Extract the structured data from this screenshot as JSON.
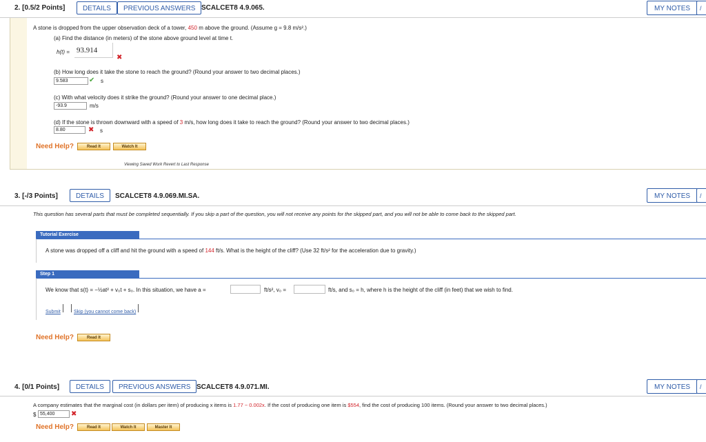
{
  "q2": {
    "number": "2.",
    "points": "[0.5/2 Points]",
    "details": "DETAILS",
    "previous": "PREVIOUS ANSWERS",
    "id": "SCALCET8 4.9.065.",
    "my_notes": "MY NOTES",
    "prompt_a": "A stone is dropped from the upper observation deck of a tower,",
    "height": "450",
    "prompt_b": "m above the ground. (Assume",
    "assume": "g = 9.8 m/s².)",
    "part_a": "(a) Find the distance (in meters) of the stone above ground level at time t.",
    "part_a_label": "h(t) =",
    "part_a_value": "93.914",
    "part_b": "(b) How long does it take the stone to reach the ground? (Round your answer to two decimal places.)",
    "part_b_value": "9.583",
    "part_b_unit": "s",
    "part_c": "(c) With what velocity does it strike the ground? (Round your answer to one decimal place.)",
    "part_c_value": "-93.9",
    "part_c_unit": "m/s",
    "part_d_a": "(d) If the stone is thrown downward with a speed of",
    "part_d_speed": "3",
    "part_d_b": "m/s, how long does it take to reach the ground? (Round your answer to two decimal places.)",
    "part_d_value": "8.80",
    "part_d_unit": "s",
    "need_help": "Need Help?",
    "read_it": "Read It",
    "watch_it": "Watch It",
    "viewing": "Viewing Saved Work Revert to Last Response"
  },
  "q3": {
    "number": "3.",
    "points": "[-/3 Points]",
    "details": "DETAILS",
    "id": "SCALCET8 4.9.069.MI.SA.",
    "my_notes": "MY NOTES",
    "notice": "This question has several parts that must be completed sequentially. If you skip a part of the question, you will not receive any points for the skipped part, and you will not be able to come back to the skipped part.",
    "tutorial": "Tutorial Exercise",
    "exercise_a": "A stone was dropped off a cliff and hit the ground with a speed of",
    "speed": "144",
    "exercise_b": "ft/s. What is the height of the cliff? (Use 32 ft/s² for the acceleration due to gravity.)",
    "step": "Step 1",
    "step_text_a": "We know that  s(t) = ",
    "step_formula": "−½at² + v₀t + s₀.",
    "step_text_b": "In this situation, we have a =",
    "step_unit1": "ft/s², v₀ =",
    "step_unit2": "ft/s, and s₀ = h, where h is the height of the cliff (in feet) that we wish to find.",
    "submit": "Submit",
    "skip": "Skip (you cannot come back)",
    "need_help": "Need Help?",
    "read_it": "Read It"
  },
  "q4": {
    "number": "4.",
    "points": "[0/1 Points]",
    "details": "DETAILS",
    "previous": "PREVIOUS ANSWERS",
    "id": "SCALCET8 4.9.071.MI.",
    "my_notes": "MY NOTES",
    "prompt_a": "A company estimates that the marginal cost (in dollars per item) of producing x items is",
    "cost": "1.77 − 0.002x",
    "prompt_b": ". If the cost of producing one item is",
    "one_item": "$554",
    "prompt_c": ", find the cost of producing 100 items. (Round your answer to two decimal places.)",
    "currency": "$",
    "value": "55,400",
    "need_help": "Need Help?",
    "read_it": "Read It",
    "watch_it": "Watch It",
    "master_it": "Master It"
  }
}
